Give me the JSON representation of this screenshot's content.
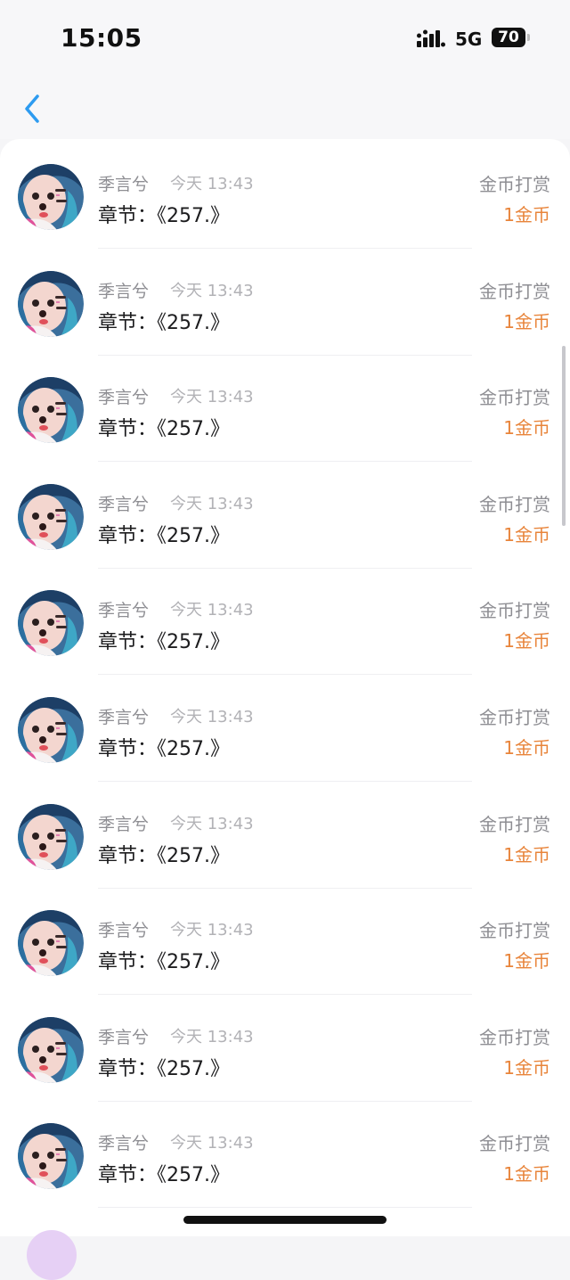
{
  "status_bar": {
    "time": "15:05",
    "network": "5G",
    "battery": "70",
    "signal_icon": "signal-bars-icon"
  },
  "nav": {
    "back_icon": "chevron-left-icon",
    "accent_color": "#2d9bf0"
  },
  "theme": {
    "amount_color": "#e8843a",
    "name_color": "#8e8e93"
  },
  "records": [
    {
      "name": "季言兮",
      "time": "今天 13:43",
      "chapter": "章节：《257.》",
      "type": "金币打赏",
      "amount": "1金币"
    },
    {
      "name": "季言兮",
      "time": "今天 13:43",
      "chapter": "章节：《257.》",
      "type": "金币打赏",
      "amount": "1金币"
    },
    {
      "name": "季言兮",
      "time": "今天 13:43",
      "chapter": "章节：《257.》",
      "type": "金币打赏",
      "amount": "1金币"
    },
    {
      "name": "季言兮",
      "time": "今天 13:43",
      "chapter": "章节：《257.》",
      "type": "金币打赏",
      "amount": "1金币"
    },
    {
      "name": "季言兮",
      "time": "今天 13:43",
      "chapter": "章节：《257.》",
      "type": "金币打赏",
      "amount": "1金币"
    },
    {
      "name": "季言兮",
      "time": "今天 13:43",
      "chapter": "章节：《257.》",
      "type": "金币打赏",
      "amount": "1金币"
    },
    {
      "name": "季言兮",
      "time": "今天 13:43",
      "chapter": "章节：《257.》",
      "type": "金币打赏",
      "amount": "1金币"
    },
    {
      "name": "季言兮",
      "time": "今天 13:43",
      "chapter": "章节：《257.》",
      "type": "金币打赏",
      "amount": "1金币"
    },
    {
      "name": "季言兮",
      "time": "今天 13:43",
      "chapter": "章节：《257.》",
      "type": "金币打赏",
      "amount": "1金币"
    },
    {
      "name": "季言兮",
      "time": "今天 13:43",
      "chapter": "章节：《257.》",
      "type": "金币打赏",
      "amount": "1金币"
    }
  ]
}
